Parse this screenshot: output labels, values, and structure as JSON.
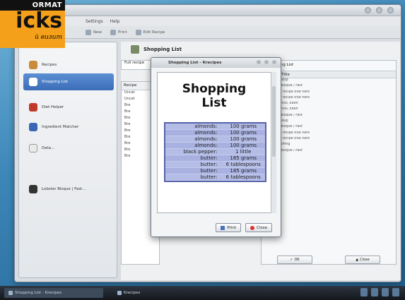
{
  "logo": {
    "band": "ORMAT",
    "big": "icks",
    "sub": "й визит"
  },
  "menubar": [
    "Settings",
    "Help"
  ],
  "toolbar": {
    "btn1": "New",
    "btn2": "Print",
    "btn3": "Edit Recipe"
  },
  "sidebar": {
    "items": [
      {
        "label": "Recipes"
      },
      {
        "label": "Shopping List"
      },
      {
        "label": "Diet Helper"
      },
      {
        "label": "Ingredient Matcher"
      },
      {
        "label": "Data..."
      },
      {
        "label": "Lobster Bisque | Fast..."
      }
    ]
  },
  "panel": {
    "title": "Shopping List",
    "tab": "Full recipe",
    "tree_header": "Recipe"
  },
  "tree": [
    "Uncat",
    "Uncat",
    "Bre",
    "Bre",
    "Bre",
    "Bre",
    "Bre",
    "Bre",
    "Bre",
    "Bre",
    "Bre"
  ],
  "right_list": {
    "header": "Shopping List",
    "column": "Recipe Title",
    "rows": [
      "Oyster Soup",
      "Lobster Bisque / Fast",
      "Type the recipe title here",
      "Type the recipe title here",
      "Pasta, Shills, Eben",
      "Pasta, Shills, Eben",
      "Lobster Bisque / Fast",
      "Oyster Soup",
      "Lobster Bisque / Fast",
      "Type the recipe title here",
      "Type the recipe title here",
      "Duck Stuffing",
      "Lobster Bisque / Fast"
    ],
    "ok": "OK",
    "close": "Close"
  },
  "dialog": {
    "title": "Shopping List - Krecipes",
    "doc_title_line1": "Shopping",
    "doc_title_line2": "List",
    "rows": [
      {
        "item": "almonds:",
        "qty": "100 grams"
      },
      {
        "item": "almonds:",
        "qty": "100 grams"
      },
      {
        "item": "almonds:",
        "qty": "100 grams"
      },
      {
        "item": "almonds:",
        "qty": "100 grams"
      },
      {
        "item": "black pepper:",
        "qty": "1 little"
      },
      {
        "item": "butter:",
        "qty": "185 grams"
      },
      {
        "item": "butter:",
        "qty": "6 tablespoons"
      },
      {
        "item": "butter:",
        "qty": "185 grams"
      },
      {
        "item": "butter:",
        "qty": "6 tablespoons"
      }
    ],
    "print": "Print",
    "close": "Close"
  },
  "taskbar": {
    "task1": "Shopping List - Krecipes",
    "task2": "Krecipes"
  }
}
